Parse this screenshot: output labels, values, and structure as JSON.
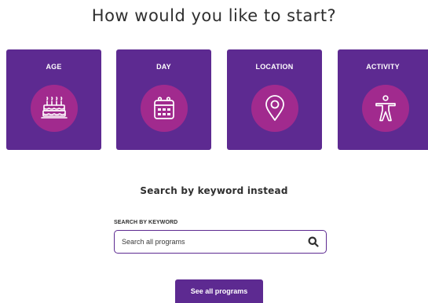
{
  "heading": "How would you like to start?",
  "cards": [
    {
      "label": "AGE",
      "icon": "birthday-cake-icon"
    },
    {
      "label": "DAY",
      "icon": "calendar-icon"
    },
    {
      "label": "LOCATION",
      "icon": "map-pin-icon"
    },
    {
      "label": "ACTIVITY",
      "icon": "person-activity-icon"
    }
  ],
  "keyword_section": {
    "title": "Search by keyword instead",
    "field_label": "SEARCH BY KEYWORD",
    "placeholder": "Search all programs",
    "value": "",
    "search_icon": "search-icon"
  },
  "see_all_button": "See all programs",
  "colors": {
    "card_bg": "#5d2a91",
    "icon_circle": "#a12a8e",
    "text": "#2f2f2f",
    "button_bg": "#5d2a91"
  }
}
